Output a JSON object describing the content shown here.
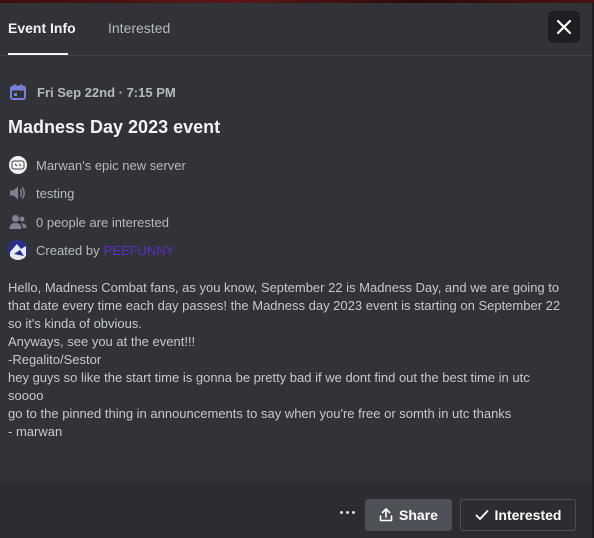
{
  "tabs": [
    {
      "label": "Event Info",
      "active": true
    },
    {
      "label": "Interested",
      "active": false
    }
  ],
  "event": {
    "date": "Fri Sep 22nd · 7:15 PM",
    "title": "Madness Day 2023 event",
    "server_name": "Marwan's epic new server",
    "channel": "testing",
    "interested_count_text": "0 people are interested",
    "created_by_label": "Created by",
    "creator_name": "PEEFUNNY"
  },
  "description_lines": [
    "Hello, Madness Combat fans, as you know, September 22 is Madness Day, and we are going to",
    "that date every time each day passes! the Madness day 2023 event is starting on September 22",
    "so it's kinda of obvious.",
    "Anyways, see you at the event!!!",
    "-Regalito/Sestor",
    "",
    "hey guys so like the start time is gonna be pretty bad if we dont find out the best time in utc",
    "soooo",
    "go to the pinned thing in announcements to say when you're free or somth in utc thanks",
    "- marwan"
  ],
  "footer": {
    "share_label": "Share",
    "interested_label": "Interested"
  },
  "colors": {
    "background": "#313338",
    "footer_bg": "#2b2d31",
    "accent_calendar": "#7b7fd8",
    "creator_name": "#5b2fc7"
  },
  "icons": {
    "calendar": "calendar-icon",
    "speaker": "speaker-icon",
    "people": "people-icon",
    "close": "close-icon",
    "share": "share-icon",
    "check": "check-icon",
    "more": "more-icon"
  }
}
